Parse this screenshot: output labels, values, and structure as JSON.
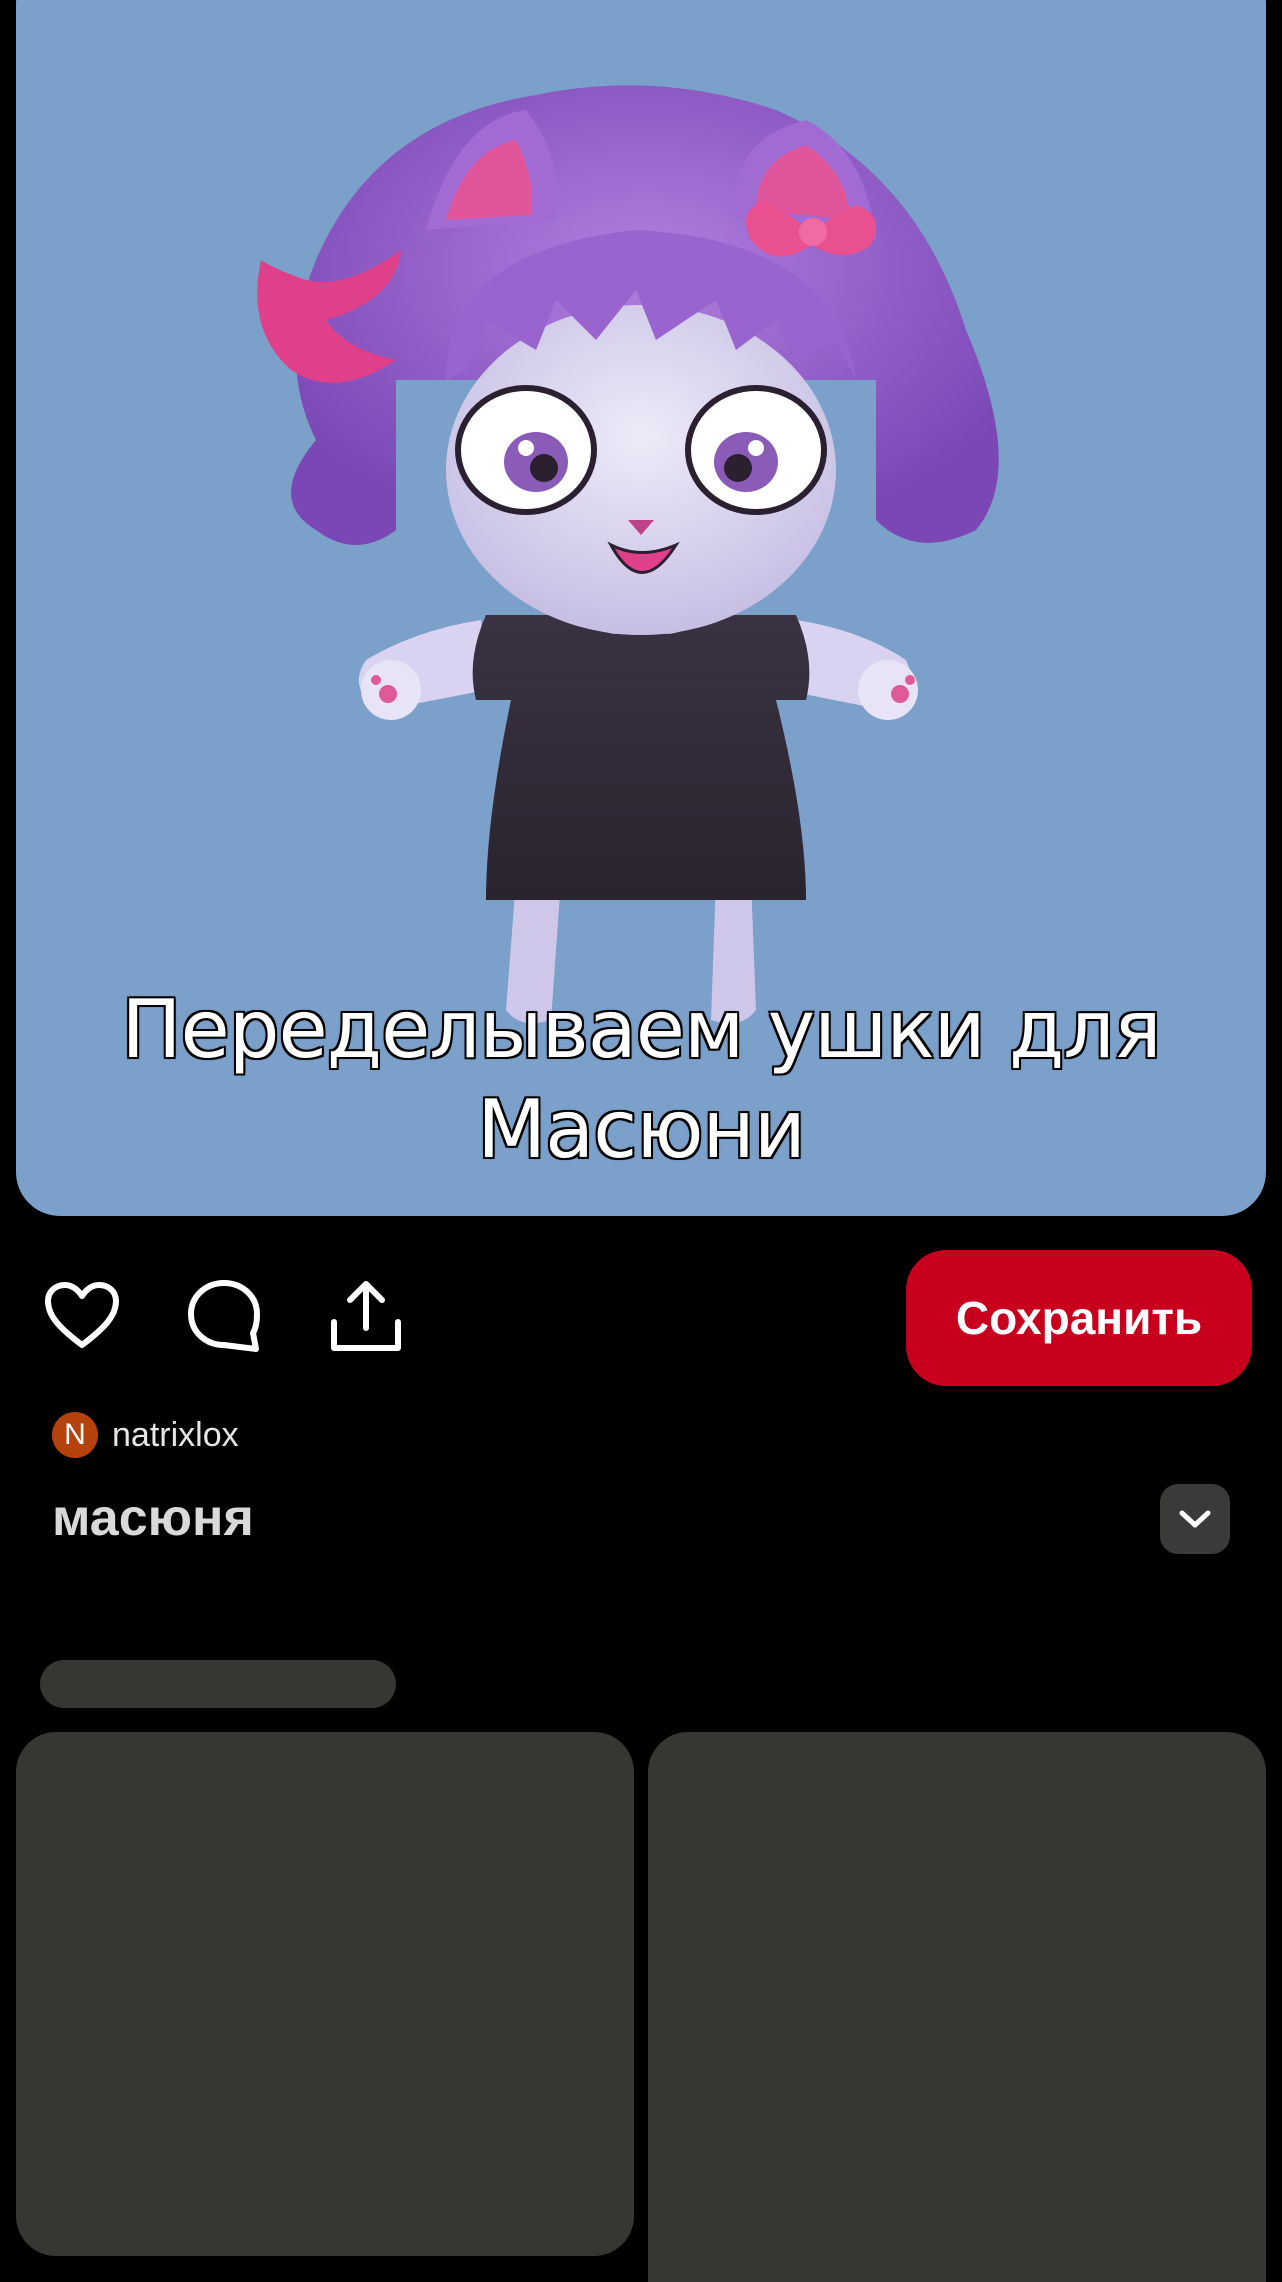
{
  "media": {
    "caption_line1": "Переделываем ушки для",
    "caption_line2": "Масюни",
    "background_color": "#7ba0c9",
    "image_description_icon": "character-image"
  },
  "actions": {
    "like_icon": "heart-icon",
    "comment_icon": "comment-icon",
    "share_icon": "share-icon",
    "save_label": "Сохранить",
    "save_color": "#c8001e"
  },
  "author": {
    "initial": "N",
    "name": "natrixlox",
    "avatar_color": "#b5420c"
  },
  "pin": {
    "title": "масюня",
    "more_icon": "chevron-down-icon"
  }
}
